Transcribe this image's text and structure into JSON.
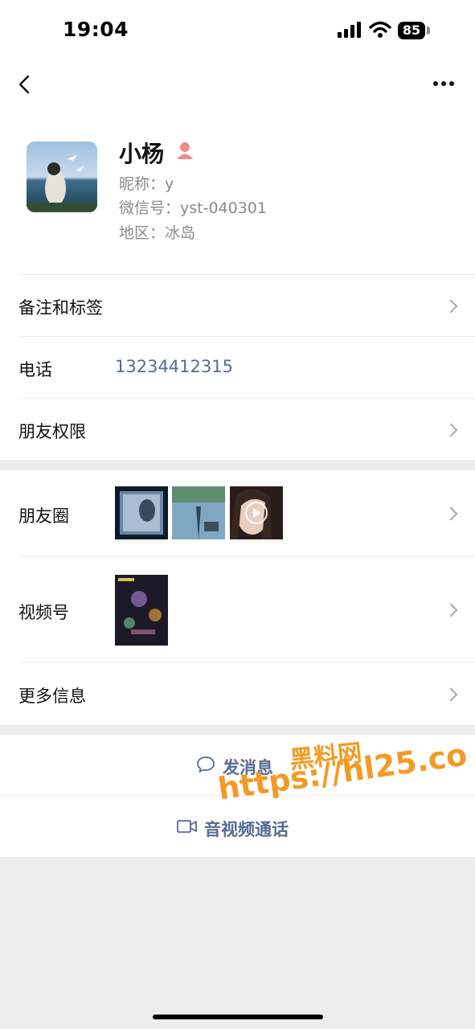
{
  "status": {
    "time": "19:04",
    "battery": "85"
  },
  "profile": {
    "name": "小杨",
    "nickname": "昵称：y",
    "wechat_id": "微信号：yst-040301",
    "region": "地区：冰岛"
  },
  "rows": {
    "remark": "备注和标签",
    "phone_label": "电话",
    "phone_value": "13234412315",
    "permissions": "朋友权限",
    "moments": "朋友圈",
    "channels": "视频号",
    "more_info": "更多信息"
  },
  "actions": {
    "message": "发消息",
    "call": "音视频通话"
  },
  "watermark": {
    "line1": "黑料网",
    "line2": "https://hl25.co"
  },
  "colors": {
    "link": "#576b95",
    "watermark": "#f39a26"
  },
  "icons": [
    "back-icon",
    "more-icon",
    "gender-icon",
    "chevron-right-icon",
    "chat-bubble-icon",
    "video-call-icon",
    "play-icon"
  ]
}
